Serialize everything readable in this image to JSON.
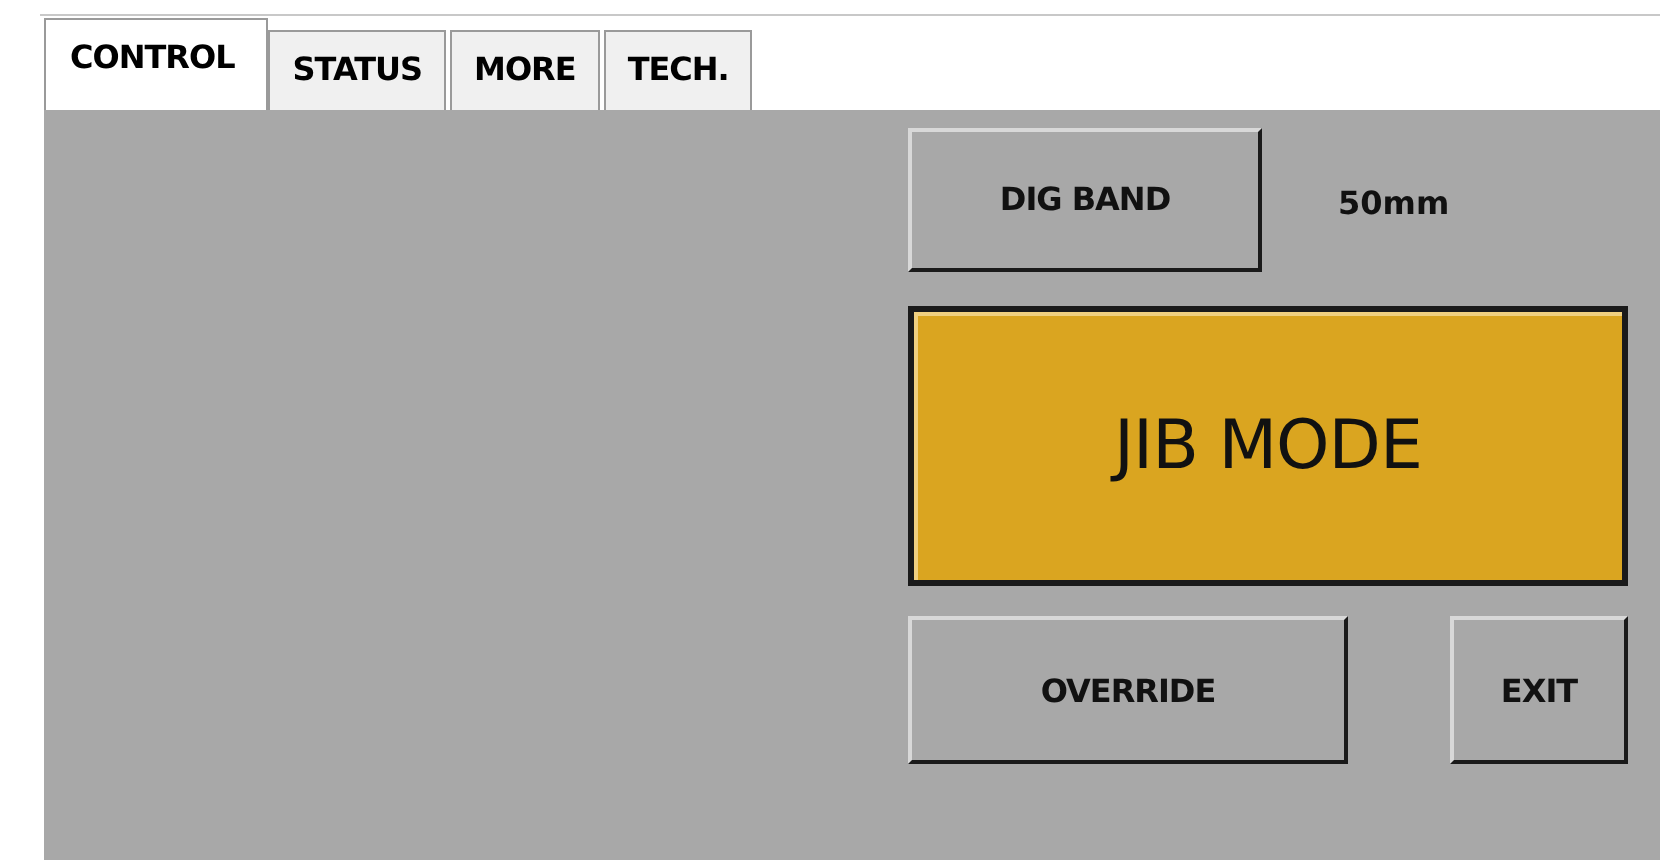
{
  "tabs": [
    {
      "label": "CONTROL",
      "selected": true
    },
    {
      "label": "STATUS",
      "selected": false
    },
    {
      "label": "MORE",
      "selected": false
    },
    {
      "label": "TECH.",
      "selected": false
    }
  ],
  "dig_band": {
    "label": "DIG BAND",
    "reading": "50mm"
  },
  "mode_button": {
    "label": "JIB MODE",
    "color": "#daa520"
  },
  "buttons": [
    {
      "label": "OVERRIDE",
      "kind": "wide"
    },
    {
      "label": "EXIT",
      "kind": "narrow"
    }
  ]
}
